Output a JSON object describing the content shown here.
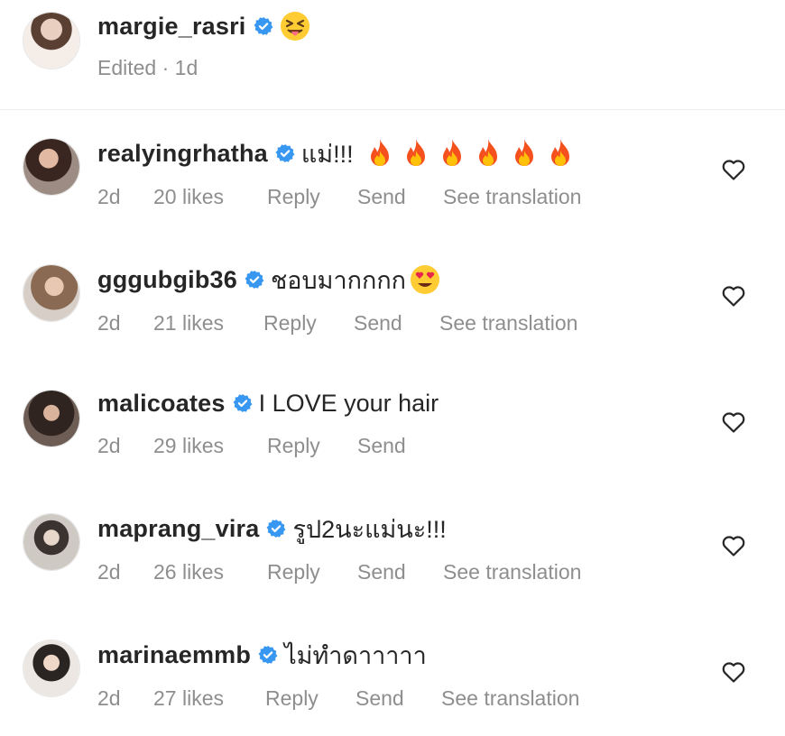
{
  "caption": {
    "username": "margie_rasri",
    "meta": "Edited · 1d",
    "emoji": "squinting-tongue-emoji"
  },
  "comments": [
    {
      "username": "realyingrhatha",
      "text": "แม่!!!",
      "emojis": "fire-x6",
      "time": "2d",
      "likes": "20 likes",
      "reply": "Reply",
      "send": "Send",
      "translate": "See translation",
      "avatar_color": "#6b4a3d"
    },
    {
      "username": "gggubgib36",
      "text": "ชอบมากกกก",
      "emojis": "heart-eyes",
      "time": "2d",
      "likes": "21 likes",
      "reply": "Reply",
      "send": "Send",
      "translate": "See translation",
      "avatar_color": "#8a6a52"
    },
    {
      "username": "malicoates",
      "text": "I LOVE your hair",
      "time": "2d",
      "likes": "29 likes",
      "reply": "Reply",
      "send": "Send",
      "avatar_color": "#4a3a32"
    },
    {
      "username": "maprang_vira",
      "text": "รูป2นะแม่นะ!!!",
      "time": "2d",
      "likes": "26 likes",
      "reply": "Reply",
      "send": "Send",
      "translate": "See translation",
      "avatar_color": "#b8b0a8"
    },
    {
      "username": "marinaemmb",
      "text": "ไม่ทำดาาาาา",
      "time": "2d",
      "likes": "27 likes",
      "reply": "Reply",
      "send": "Send",
      "translate": "See translation",
      "avatar_color": "#d8cfc6"
    }
  ],
  "colors": {
    "verified": "#3897f0",
    "text": "#262626",
    "meta": "#8e8e8e"
  }
}
